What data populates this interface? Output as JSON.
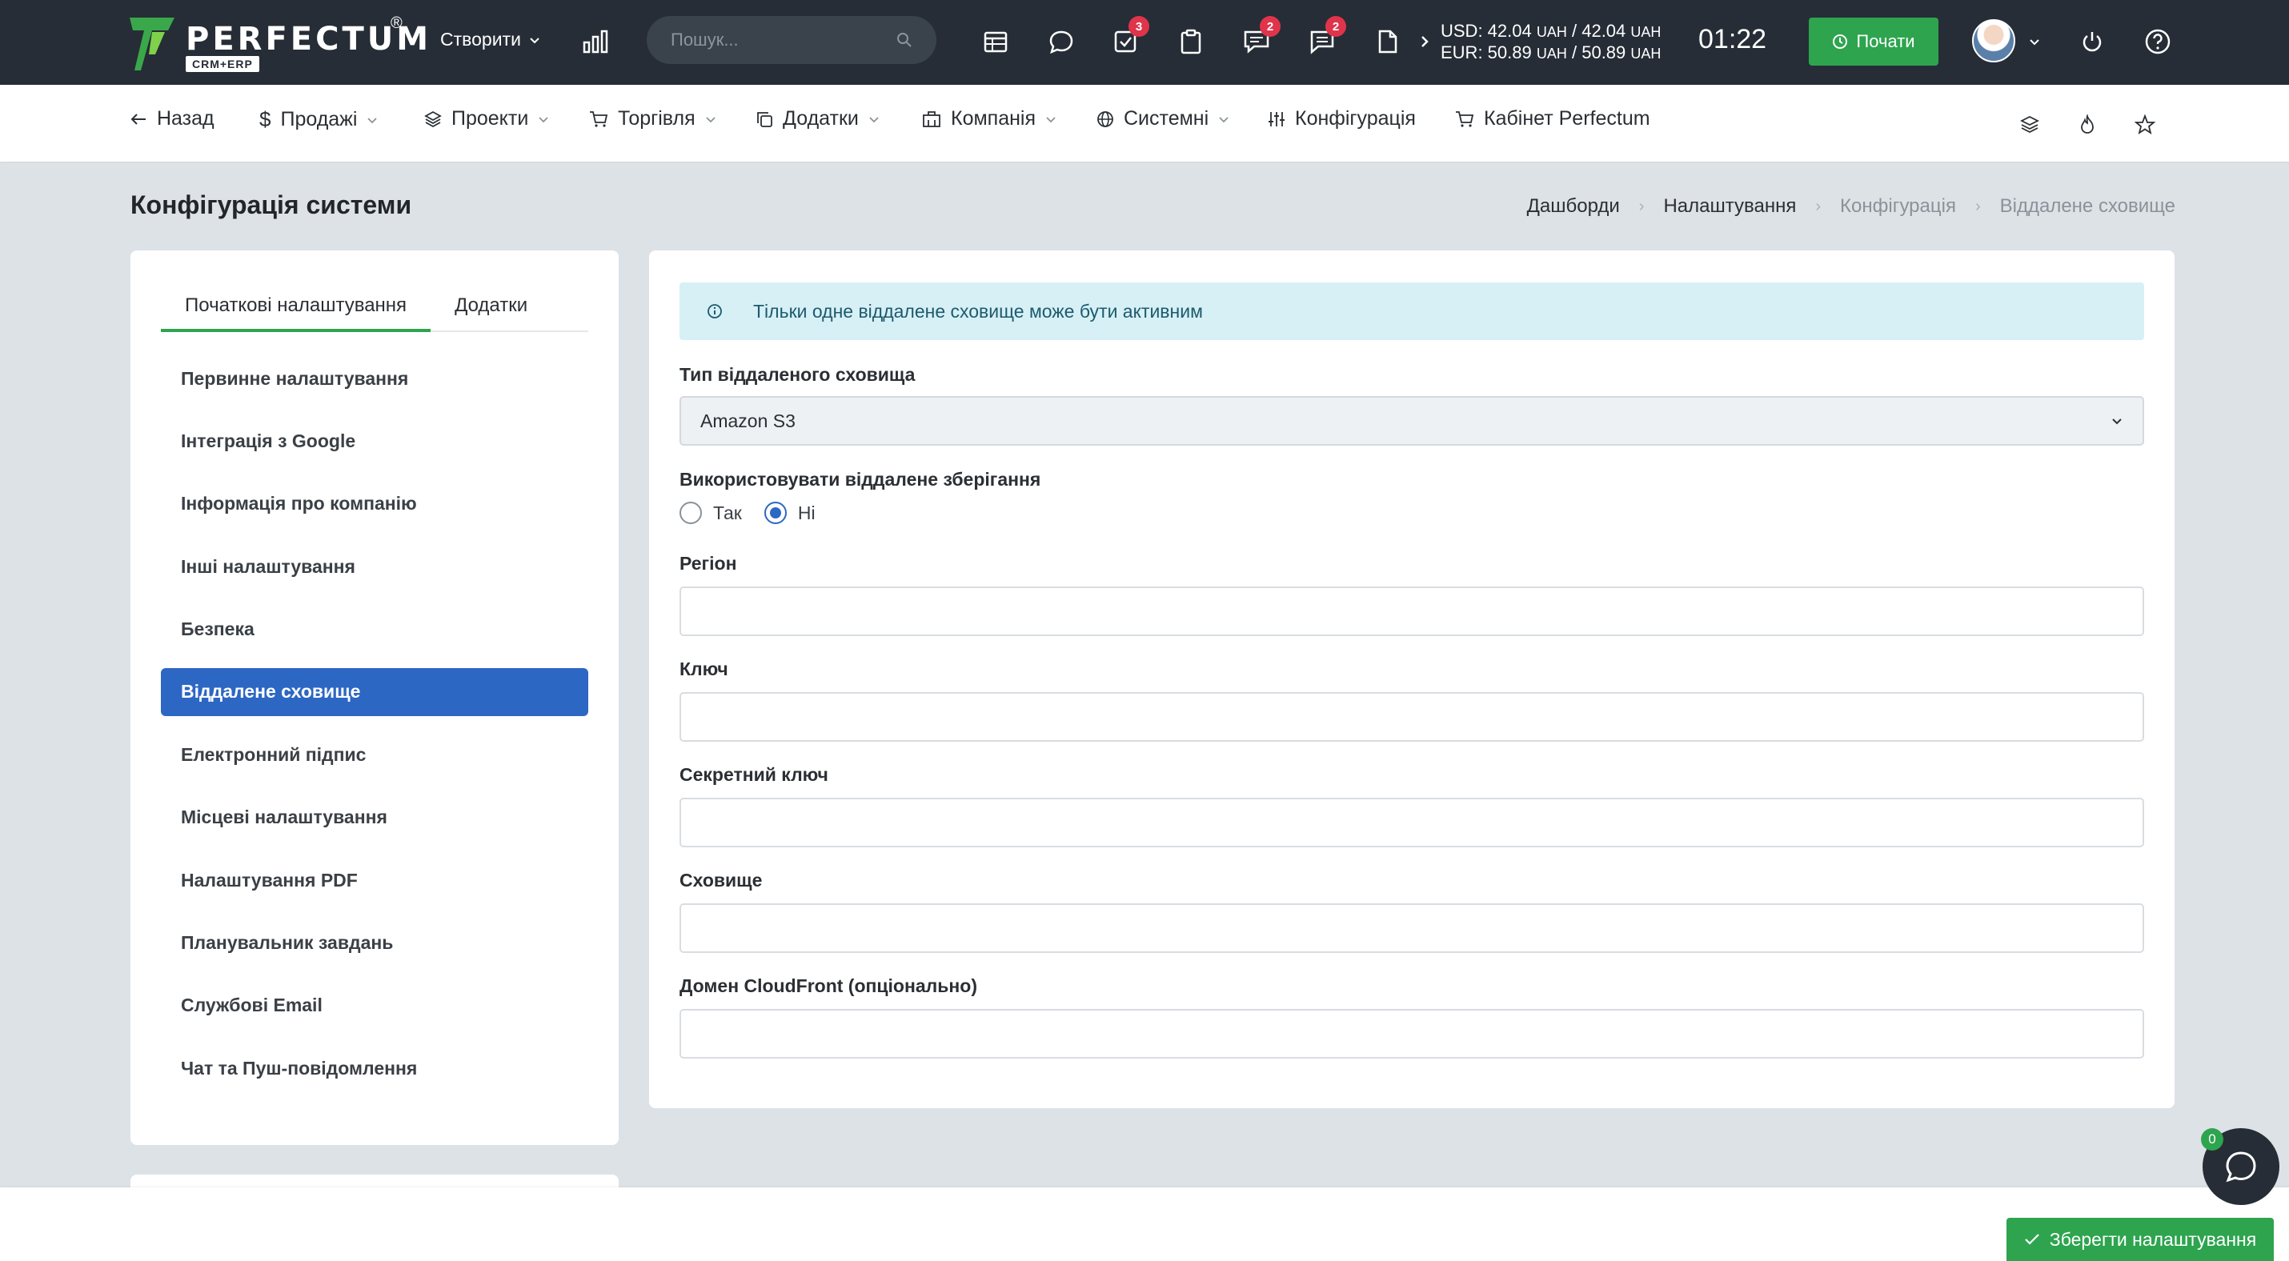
{
  "topbar": {
    "logo": {
      "word": "PERFECTUM",
      "reg": "®",
      "sub": "CRM+ERP"
    },
    "create_label": "Створити",
    "search": {
      "placeholder": "Пошук..."
    },
    "badges": {
      "tasks": "3",
      "support": "2",
      "messages": "2"
    },
    "rates": {
      "usd": "USD: 42.04",
      "usd_sell": "42.04",
      "eur": "EUR: 50.89",
      "eur_sell": "50.89",
      "currency": "UAH"
    },
    "clock": "01:22",
    "start_label": "Почати"
  },
  "nav": {
    "back": "Назад",
    "sales": "Продажі",
    "projects": "Проекти",
    "trade": "Торгівля",
    "addons": "Додатки",
    "company": "Компанія",
    "system": "Системні",
    "config": "Конфігурація",
    "cabinet": "Кабінет Perfectum"
  },
  "page": {
    "title": "Конфігурація системи",
    "breadcrumb": [
      "Дашборди",
      "Налаштування",
      "Конфігурація",
      "Віддалене сховище"
    ]
  },
  "settings": {
    "tabs": [
      "Початкові налаштування",
      "Додатки"
    ],
    "menu": [
      "Первинне налаштування",
      "Інтеграція з Google",
      "Інформація про компанію",
      "Інші налаштування",
      "Безпека",
      "Віддалене сховище",
      "Електронний підпис",
      "Місцеві налаштування",
      "Налаштування PDF",
      "Планувальник завдань",
      "Службові Email",
      "Чат та Пуш-повідомлення"
    ],
    "active_index": 5
  },
  "form": {
    "alert": "Тільки одне віддалене сховище може бути активним",
    "storage_type_label": "Тип віддаленого сховища",
    "storage_type_value": "Amazon S3",
    "use_remote_label": "Використовувати віддалене зберігання",
    "radio_yes": "Так",
    "radio_no": "Ні",
    "radio_selected": "no",
    "region_label": "Регіон",
    "region_value": "",
    "key_label": "Ключ",
    "key_value": "",
    "secret_label": "Секретний ключ",
    "secret_value": "",
    "bucket_label": "Сховище",
    "bucket_value": "",
    "cloudfront_label": "Домен CloudFront (опціонально)",
    "cloudfront_value": ""
  },
  "footer": {
    "save_label": "Зберегти налаштування",
    "chat_count": "0"
  },
  "colors": {
    "topbar": "#262d36",
    "accent_green": "#2ea44f",
    "active_blue": "#2d67c4",
    "badge_red": "#e0344b",
    "alert_bg": "#d6f0f6"
  }
}
